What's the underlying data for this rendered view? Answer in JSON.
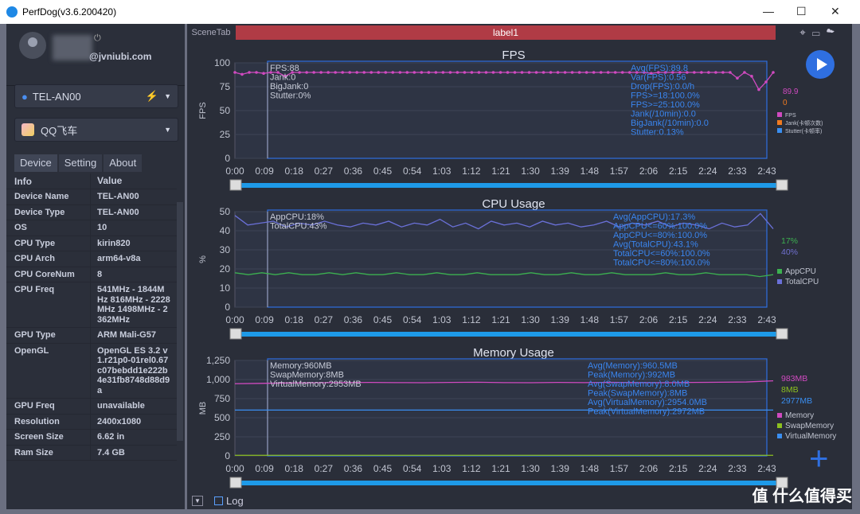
{
  "window": {
    "title": "PerfDog(v3.6.200420)",
    "minimize": "—",
    "maximize": "☐",
    "close": "✕"
  },
  "user": {
    "email": "@jvniubi.com",
    "power": "⏻"
  },
  "device_select": {
    "value": "TEL-AN00"
  },
  "app_select": {
    "value": "QQ飞车"
  },
  "tabs": [
    {
      "label": "Device"
    },
    {
      "label": "Setting"
    },
    {
      "label": "About"
    }
  ],
  "info_table": {
    "headers": [
      "Info",
      "Value"
    ],
    "rows": [
      [
        "Device Name",
        "TEL-AN00"
      ],
      [
        "Device Type",
        "TEL-AN00"
      ],
      [
        "OS",
        "10"
      ],
      [
        "CPU Type",
        "kirin820"
      ],
      [
        "CPU Arch",
        "arm64-v8a"
      ],
      [
        "CPU CoreNum",
        "8"
      ],
      [
        "CPU Freq",
        "541MHz - 1844MHz 816MHz - 2228MHz 1498MHz - 2362MHz"
      ],
      [
        "GPU Type",
        "ARM Mali-G57"
      ],
      [
        "OpenGL",
        "OpenGL ES 3.2 v1.r21p0-01rel0.67c07bebdd1e222b4e31fb8748d88d9a"
      ],
      [
        "GPU Freq",
        "unavailable"
      ],
      [
        "Resolution",
        "2400x1080"
      ],
      [
        "Screen Size",
        "6.62 in"
      ],
      [
        "Ram Size",
        "7.4 GB"
      ]
    ]
  },
  "scene": {
    "tab": "SceneTab",
    "label": "label1"
  },
  "footer": {
    "log": "Log"
  },
  "watermark": "值 什么值得买",
  "chart_data": [
    {
      "type": "line",
      "title": "FPS",
      "ylabel": "FPS",
      "ylim": [
        0,
        100
      ],
      "yticks": [
        0,
        25,
        50,
        75,
        100
      ],
      "xticks": [
        "0:00",
        "0:09",
        "0:18",
        "0:27",
        "0:36",
        "0:45",
        "0:54",
        "1:03",
        "1:12",
        "1:21",
        "1:30",
        "1:39",
        "1:48",
        "1:57",
        "2:06",
        "2:15",
        "2:24",
        "2:33",
        "2:43"
      ],
      "cursor_label_lines": [
        "FPS:88",
        "Jank:0",
        "BigJank:0",
        "Stutter:0%"
      ],
      "stats": [
        "Avg(FPS):89.8",
        "Var(FPS):0.56",
        "Drop(FPS):0.0/h",
        "FPS>=18:100.0%",
        "FPS>=25:100.0%",
        "Jank(/10min):0.0",
        "BigJank(/10min):0.0",
        "Stutter:0.13%"
      ],
      "current": [
        {
          "text": "89.9",
          "color": "#d04ac0"
        },
        {
          "text": "0",
          "color": "#f07a20"
        }
      ],
      "series": [
        {
          "name": "FPS",
          "color": "#d04ac0",
          "values": [
            90,
            88,
            90,
            90,
            89,
            90,
            90,
            86,
            90,
            90,
            90,
            90,
            90,
            90,
            90,
            90,
            90,
            90,
            90,
            90,
            90,
            90,
            90,
            90,
            90,
            90,
            90,
            90,
            90,
            90,
            90,
            90,
            90,
            90,
            90,
            90,
            90,
            90,
            90,
            90,
            90,
            90,
            90,
            90,
            90,
            90,
            90,
            90,
            90,
            90,
            90,
            90,
            90,
            90,
            90,
            90,
            90,
            90,
            89,
            90,
            90,
            90,
            90,
            90,
            90,
            90,
            90,
            90,
            90,
            90,
            84,
            90,
            86,
            72,
            80,
            90
          ]
        },
        {
          "name": "Jank(卡顿次数)",
          "color": "#f07a20",
          "values": []
        },
        {
          "name": "Stutter(卡顿率)",
          "color": "#3a8ef0",
          "values": []
        }
      ]
    },
    {
      "type": "line",
      "title": "CPU Usage",
      "ylabel": "%",
      "ylim": [
        0,
        50
      ],
      "yticks": [
        0,
        10,
        20,
        30,
        40,
        50
      ],
      "xticks": [
        "0:00",
        "0:09",
        "0:18",
        "0:27",
        "0:36",
        "0:45",
        "0:54",
        "1:03",
        "1:12",
        "1:21",
        "1:30",
        "1:39",
        "1:48",
        "1:57",
        "2:06",
        "2:15",
        "2:24",
        "2:33",
        "2:43"
      ],
      "cursor_label_lines": [
        "AppCPU:18%",
        "TotalCPU:43%"
      ],
      "stats": [
        "Avg(AppCPU):17.3%",
        "AppCPU<=60%:100.0%",
        "AppCPU<=80%:100.0%",
        "Avg(TotalCPU):43.1%",
        "TotalCPU<=60%:100.0%",
        "TotalCPU<=80%:100.0%"
      ],
      "current": [
        {
          "text": "17%",
          "color": "#3cb050"
        },
        {
          "text": "40%",
          "color": "#7070d0"
        }
      ],
      "series": [
        {
          "name": "AppCPU",
          "color": "#3cb050",
          "values": [
            18,
            17,
            18,
            17,
            18,
            17,
            17,
            18,
            17,
            18,
            17,
            17,
            18,
            17,
            17,
            18,
            17,
            17,
            18,
            17,
            17,
            17,
            18,
            17,
            17,
            18,
            17,
            17,
            18,
            17,
            17,
            17,
            18,
            17,
            17,
            18,
            17,
            17,
            17,
            16,
            17
          ]
        },
        {
          "name": "TotalCPU",
          "color": "#6a70d8",
          "values": [
            48,
            43,
            44,
            45,
            42,
            44,
            43,
            45,
            43,
            42,
            44,
            43,
            45,
            42,
            44,
            43,
            46,
            42,
            44,
            41,
            45,
            43,
            44,
            42,
            45,
            43,
            44,
            42,
            43,
            45,
            42,
            44,
            43,
            45,
            42,
            44,
            43,
            41,
            44,
            42,
            43,
            49,
            41
          ]
        }
      ]
    },
    {
      "type": "line",
      "title": "Memory Usage",
      "ylabel": "MB",
      "ylim": [
        0,
        1250
      ],
      "yticks": [
        0,
        250,
        500,
        750,
        "1,000",
        "1,250"
      ],
      "xticks": [
        "0:00",
        "0:09",
        "0:18",
        "0:27",
        "0:36",
        "0:45",
        "0:54",
        "1:03",
        "1:12",
        "1:21",
        "1:30",
        "1:39",
        "1:48",
        "1:57",
        "2:06",
        "2:15",
        "2:24",
        "2:33",
        "2:43"
      ],
      "cursor_label_lines": [
        "Memory:960MB",
        "SwapMemory:8MB",
        "VirtualMemory:2953MB"
      ],
      "stats": [
        "Avg(Memory):960.5MB",
        "Peak(Memory):992MB",
        "Avg(SwapMemory):8.0MB",
        "Peak(SwapMemory):8MB",
        "Avg(VirtualMemory):2954.0MB",
        "Peak(VirtualMemory):2972MB"
      ],
      "current": [
        {
          "text": "983MB",
          "color": "#d04ac0"
        },
        {
          "text": "8MB",
          "color": "#8cc020"
        },
        {
          "text": "2977MB",
          "color": "#3a8ef0"
        }
      ],
      "series": [
        {
          "name": "Memory",
          "color": "#d04ac0",
          "values": [
            945,
            950,
            955,
            958,
            960,
            962,
            960,
            958,
            962,
            965,
            960,
            958,
            962,
            960,
            963,
            960,
            958,
            962,
            965,
            968,
            983
          ]
        },
        {
          "name": "SwapMemory",
          "color": "#8cc020",
          "values": [
            8,
            8,
            8,
            8,
            8,
            8,
            8,
            8,
            8,
            8,
            8,
            8,
            8,
            8,
            8,
            8,
            8,
            8,
            8,
            8,
            8
          ]
        },
        {
          "name": "VirtualMemory",
          "color": "#3a8ef0",
          "values": [
            600,
            600,
            600,
            600,
            600,
            600,
            600,
            600,
            600,
            600,
            600,
            600,
            600,
            600,
            600,
            600,
            600,
            600,
            600,
            600,
            600
          ]
        }
      ]
    }
  ]
}
